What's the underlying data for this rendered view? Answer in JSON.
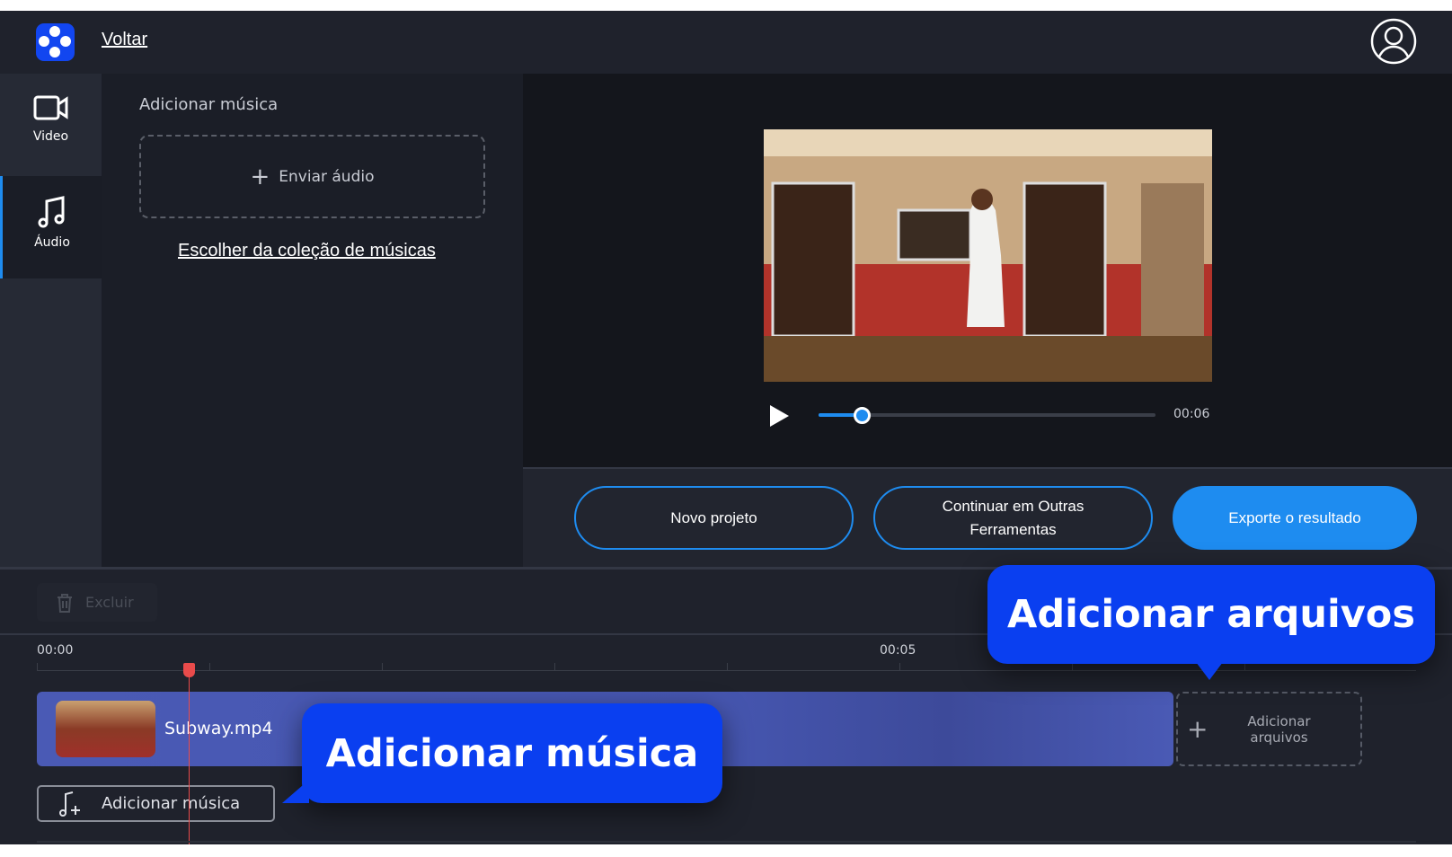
{
  "header": {
    "back_link": "Voltar"
  },
  "sidebar": {
    "items": [
      {
        "label": "Video",
        "icon": "video-camera-icon"
      },
      {
        "label": "Áudio",
        "icon": "music-note-icon",
        "active": true
      }
    ]
  },
  "panel": {
    "title": "Adicionar música",
    "upload_label": "Enviar áudio",
    "collection_link": "Escolher da coleção de músicas"
  },
  "player": {
    "time": "00:06",
    "progress_fraction": 0.13
  },
  "actions": {
    "new_project": "Novo projeto",
    "continue_tools": "Continuar em Outras Ferramentas",
    "export": "Exporte o resultado"
  },
  "toolbar": {
    "delete_label": "Excluir"
  },
  "timeline": {
    "ticks": [
      "00:00",
      "00:05"
    ],
    "clip_name": "Subway.mp4",
    "add_files_label": "Adicionar arquivos",
    "add_music_label": "Adicionar música"
  },
  "tooltips": {
    "music": "Adicionar música",
    "files": "Adicionar arquivos"
  },
  "colors": {
    "accent": "#1e8cf0",
    "tooltip": "#0a3ff0",
    "playhead": "#e94b4b",
    "clip": "#4a5ab5"
  }
}
